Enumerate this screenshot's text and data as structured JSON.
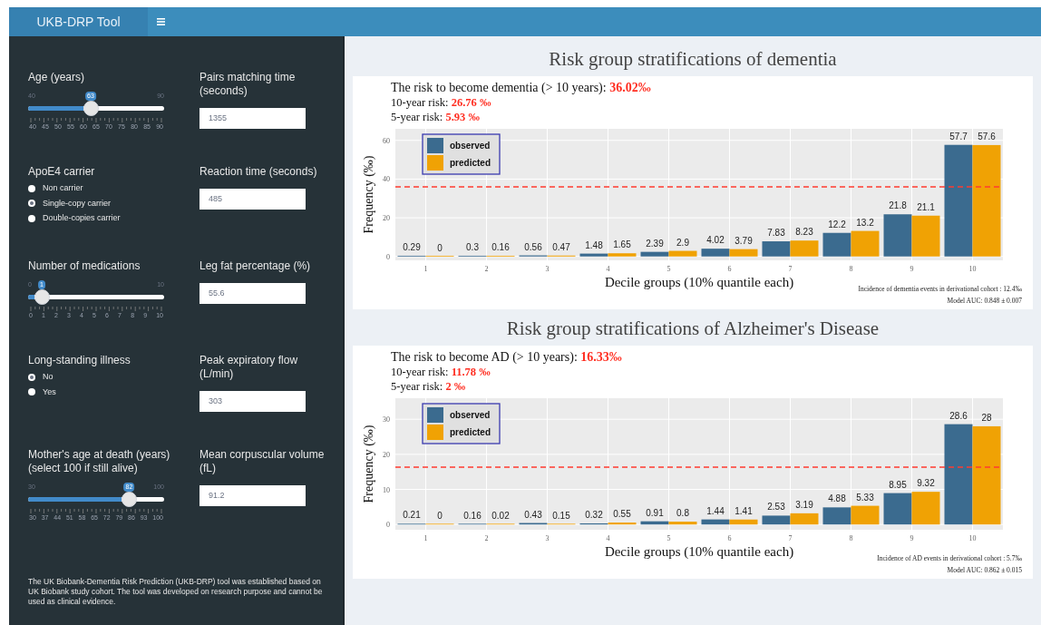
{
  "header": {
    "title": "UKB-DRP Tool"
  },
  "sidebar": {
    "rows": [
      {
        "left": {
          "kind": "slider",
          "label": "Age (years)",
          "min": "40",
          "max": "90",
          "value": "63",
          "level": 0.46,
          "ticks": [
            "40",
            "45",
            "50",
            "55",
            "60",
            "65",
            "70",
            "75",
            "80",
            "85",
            "90"
          ]
        },
        "right": {
          "kind": "number",
          "label": "Pairs matching time (seconds)",
          "value": "1355"
        }
      },
      {
        "left": {
          "kind": "radio",
          "label": "ApoE4 carrier",
          "options": [
            {
              "label": "Non carrier",
              "selected": false
            },
            {
              "label": "Single-copy carrier",
              "selected": true
            },
            {
              "label": "Double-copies carrier",
              "selected": false
            }
          ]
        },
        "right": {
          "kind": "number",
          "label": "Reaction time (seconds)",
          "value": "485"
        }
      },
      {
        "left": {
          "kind": "slider",
          "label": "Number of medications",
          "min": "0",
          "max": "10",
          "value": "1",
          "level": 0.1,
          "ticks": [
            "0",
            "1",
            "2",
            "3",
            "4",
            "5",
            "6",
            "7",
            "8",
            "9",
            "10"
          ]
        },
        "right": {
          "kind": "number",
          "label": "Leg fat percentage (%)",
          "value": "55.6"
        }
      },
      {
        "left": {
          "kind": "radio",
          "label": "Long-standing illness",
          "options": [
            {
              "label": "No",
              "selected": true
            },
            {
              "label": "Yes",
              "selected": false
            }
          ]
        },
        "right": {
          "kind": "number",
          "label": "Peak expiratory flow (L/min)",
          "value": "303"
        }
      },
      {
        "left": {
          "kind": "slider",
          "label": "Mother's age at death (years) (select 100 if still alive)",
          "min": "30",
          "max": "100",
          "value": "82",
          "level": 0.743,
          "ticks": [
            "30",
            "37",
            "44",
            "51",
            "58",
            "65",
            "72",
            "79",
            "86",
            "93",
            "100"
          ]
        },
        "right": {
          "kind": "number",
          "label": "Mean corpuscular volume (fL)",
          "value": "91.2"
        }
      }
    ],
    "note": "The UK Biobank-Dementia Risk Prediction (UKB-DRP) tool was established based on UK Biobank study cohort. The tool was developed on research purpose and cannot be used as clinical evidence."
  },
  "panels": [
    {
      "title": "Risk group stratifications of dementia",
      "summary": [
        {
          "label": "The risk to become dementia (> 10 years):",
          "value": "36.02‰"
        },
        {
          "label": "10-year risk:",
          "value": "26.76 ‰"
        },
        {
          "label": "5-year risk:",
          "value": "5.93 ‰"
        }
      ],
      "chart_data": {
        "type": "bar",
        "xlabel": "Decile groups (10% quantile each)",
        "ylabel": "Frequency (‰)",
        "categories": [
          "1",
          "2",
          "3",
          "4",
          "5",
          "6",
          "7",
          "8",
          "9",
          "10"
        ],
        "series": [
          {
            "name": "observed",
            "color": "#3b6b8f",
            "values": [
              0.29,
              0.3,
              0.56,
              1.48,
              2.39,
              4.02,
              7.83,
              12.2,
              21.8,
              57.7
            ]
          },
          {
            "name": "predicted",
            "color": "#f0a204",
            "values": [
              0,
              0.16,
              0.47,
              1.65,
              2.9,
              3.79,
              8.23,
              13.2,
              21.1,
              57.6
            ]
          }
        ],
        "ylim": [
          -2,
          66
        ],
        "yticks": [
          0,
          20,
          40,
          60
        ],
        "data_labels": true,
        "grid": true,
        "legend": true,
        "ref_lines": [
          {
            "axis": "y",
            "value": 36.02,
            "color": "#ff3b30"
          }
        ]
      },
      "notes": [
        "Incidence of dementia events in derivational cohort : 12.4‰",
        "Model AUC: 0.848 ± 0.007"
      ]
    },
    {
      "title": "Risk group stratifications of Alzheimer's Disease",
      "summary": [
        {
          "label": "The risk to become AD (> 10 years):",
          "value": "16.33‰"
        },
        {
          "label": "10-year risk:",
          "value": "11.78 ‰"
        },
        {
          "label": "5-year risk:",
          "value": "2 ‰"
        }
      ],
      "chart_data": {
        "type": "bar",
        "xlabel": "Decile groups (10% quantile each)",
        "ylabel": "Frequency (‰)",
        "categories": [
          "1",
          "2",
          "3",
          "4",
          "5",
          "6",
          "7",
          "8",
          "9",
          "10"
        ],
        "series": [
          {
            "name": "observed",
            "color": "#3b6b8f",
            "values": [
              0.21,
              0.16,
              0.43,
              0.32,
              0.91,
              1.44,
              2.53,
              4.88,
              8.95,
              28.6
            ]
          },
          {
            "name": "predicted",
            "color": "#f0a204",
            "values": [
              0,
              0.02,
              0.15,
              0.55,
              0.8,
              1.41,
              3.19,
              5.33,
              9.32,
              28
            ]
          }
        ],
        "ylim": [
          -1.5,
          36
        ],
        "yticks": [
          0,
          10,
          20,
          30
        ],
        "data_labels": true,
        "grid": true,
        "legend": true,
        "ref_lines": [
          {
            "axis": "y",
            "value": 16.33,
            "color": "#ff3b30"
          }
        ]
      },
      "notes": [
        "Incidence of AD events in derivational cohort : 5.7‰",
        "Model AUC: 0.862 ± 0.015"
      ]
    }
  ]
}
